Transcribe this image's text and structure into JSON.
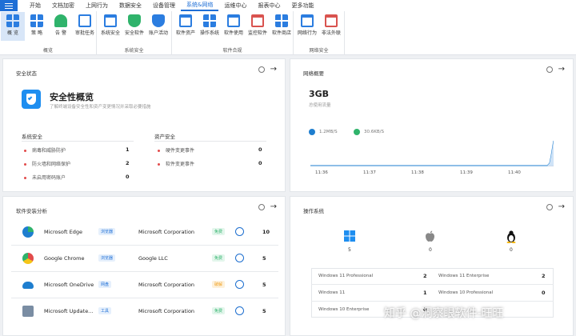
{
  "menu": {
    "items": [
      "开始",
      "文档加密",
      "上网行为",
      "数据安全",
      "设备管理",
      "系统&网络",
      "运维中心",
      "报表中心",
      "更多功能"
    ],
    "active_index": 5
  },
  "ribbon": {
    "groups": [
      {
        "title": "概览",
        "items": [
          "概 览",
          "策 略",
          "告 警",
          "审批任务"
        ]
      },
      {
        "title": "系统安全",
        "items": [
          "系统安全",
          "安全软件",
          "账户活动"
        ]
      },
      {
        "title": "软件合规",
        "items": [
          "软件资产",
          "操作系统",
          "软件使用",
          "监控软件",
          "软件商店"
        ]
      },
      {
        "title": "网络安全",
        "items": [
          "网络行为",
          "非法外联"
        ]
      }
    ]
  },
  "security": {
    "title": "安全状态",
    "hero_title": "安全性概览",
    "hero_sub": "了解终端设备安全性和资产变更情况并采取必要措施",
    "left_title": "系统安全",
    "left_rows": [
      {
        "label": "病毒和威胁防护",
        "value": "1"
      },
      {
        "label": "防火墙和网络保护",
        "value": "2"
      },
      {
        "label": "未启用密码账户",
        "value": "0"
      }
    ],
    "right_title": "资产安全",
    "right_rows": [
      {
        "label": "硬件变更事件",
        "value": "0"
      },
      {
        "label": "软件变更事件",
        "value": "0"
      }
    ]
  },
  "network": {
    "title": "网络概要",
    "total": "3GB",
    "total_label": "总使用流量",
    "upload": "1.2MB/S",
    "download": "30.6KB/S",
    "ticks": [
      "11:36",
      "11:37",
      "11:38",
      "11:39",
      "11:40"
    ]
  },
  "software": {
    "title": "软件安装分析",
    "rows": [
      {
        "name": "Microsoft Edge",
        "tag": "浏览器",
        "vendor": "Microsoft Corporation",
        "status": "免费",
        "count": "10"
      },
      {
        "name": "Google Chrome",
        "tag": "浏览器",
        "vendor": "Google LLC",
        "status": "免费",
        "count": "5"
      },
      {
        "name": "Microsoft OneDrive",
        "tag": "网盘",
        "vendor": "Microsoft Corporation",
        "status": "破解",
        "count": "5"
      },
      {
        "name": "Microsoft Update...",
        "tag": "工具",
        "vendor": "Microsoft Corporation",
        "status": "免费",
        "count": "5"
      }
    ]
  },
  "os": {
    "title": "操作系统",
    "counts": [
      "5",
      "0",
      "0"
    ],
    "rows": [
      {
        "left": "Windows 11 Professional",
        "left_count": "2",
        "right": "Windows 11 Enterprise",
        "right_count": "2"
      },
      {
        "left": "Windows 11",
        "left_count": "1",
        "right": "Windows 10 Professional",
        "right_count": "0"
      },
      {
        "left": "Windows 10 Enterprise",
        "left_count": "0",
        "right": "",
        "right_count": ""
      }
    ]
  },
  "watermark": "知乎 @洞察眼软件-旺旺",
  "colors": {
    "accent": "#1f6fd6",
    "free_green": "#2fb36b",
    "crack_orange": "#f0a020"
  }
}
